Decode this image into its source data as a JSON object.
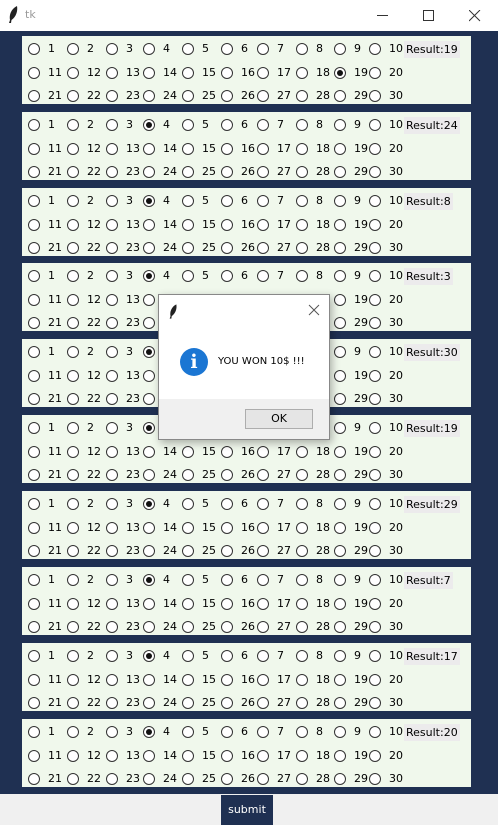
{
  "window": {
    "title": "tk"
  },
  "panels": [
    {
      "result": "Result:19",
      "selected": 19
    },
    {
      "result": "Result:24",
      "selected": 4
    },
    {
      "result": "Result:8",
      "selected": 4
    },
    {
      "result": "Result:3",
      "selected": 4
    },
    {
      "result": "Result:30",
      "selected": 4
    },
    {
      "result": "Result:19",
      "selected": 4
    },
    {
      "result": "Result:29",
      "selected": 4
    },
    {
      "result": "Result:7",
      "selected": 4
    },
    {
      "result": "Result:17",
      "selected": 4
    },
    {
      "result": "Result:20",
      "selected": 4
    }
  ],
  "numbers": [
    1,
    2,
    3,
    4,
    5,
    6,
    7,
    8,
    9,
    10,
    11,
    12,
    13,
    14,
    15,
    16,
    17,
    18,
    19,
    20,
    21,
    22,
    23,
    24,
    25,
    26,
    27,
    28,
    29,
    30
  ],
  "submit_label": "submit",
  "dialog": {
    "message": "YOU WON 10$ !!!",
    "ok_label": "OK",
    "icon": "info-icon"
  }
}
